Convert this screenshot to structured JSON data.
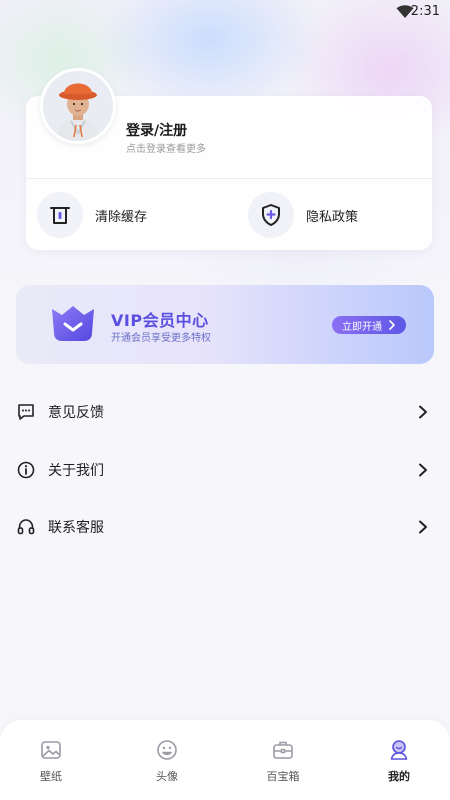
{
  "status_bar": {
    "time": "2:31",
    "wifi_icon": "wifi-icon"
  },
  "profile": {
    "login_title": "登录/注册",
    "login_subtitle": "点击登录查看更多",
    "avatar_icon": "avatar-3d-character"
  },
  "quick_actions": [
    {
      "label": "清除缓存",
      "icon": "trash-icon"
    },
    {
      "label": "隐私政策",
      "icon": "shield-icon"
    }
  ],
  "vip": {
    "title": "VIP会员中心",
    "subtitle": "开通会员享受更多特权",
    "button_label": "立即开通",
    "icon": "crown-badge-icon",
    "accent": "#5a4fe0"
  },
  "menu": [
    {
      "label": "意见反馈",
      "icon": "chat-bubble-icon"
    },
    {
      "label": "关于我们",
      "icon": "info-icon"
    },
    {
      "label": "联系客服",
      "icon": "headset-icon"
    }
  ],
  "tabbar": {
    "tabs": [
      {
        "label": "壁纸",
        "icon": "image-icon",
        "active": false
      },
      {
        "label": "头像",
        "icon": "face-icon",
        "active": false
      },
      {
        "label": "百宝箱",
        "icon": "toolbox-icon",
        "active": false
      },
      {
        "label": "我的",
        "icon": "user-icon",
        "active": true
      }
    ]
  }
}
